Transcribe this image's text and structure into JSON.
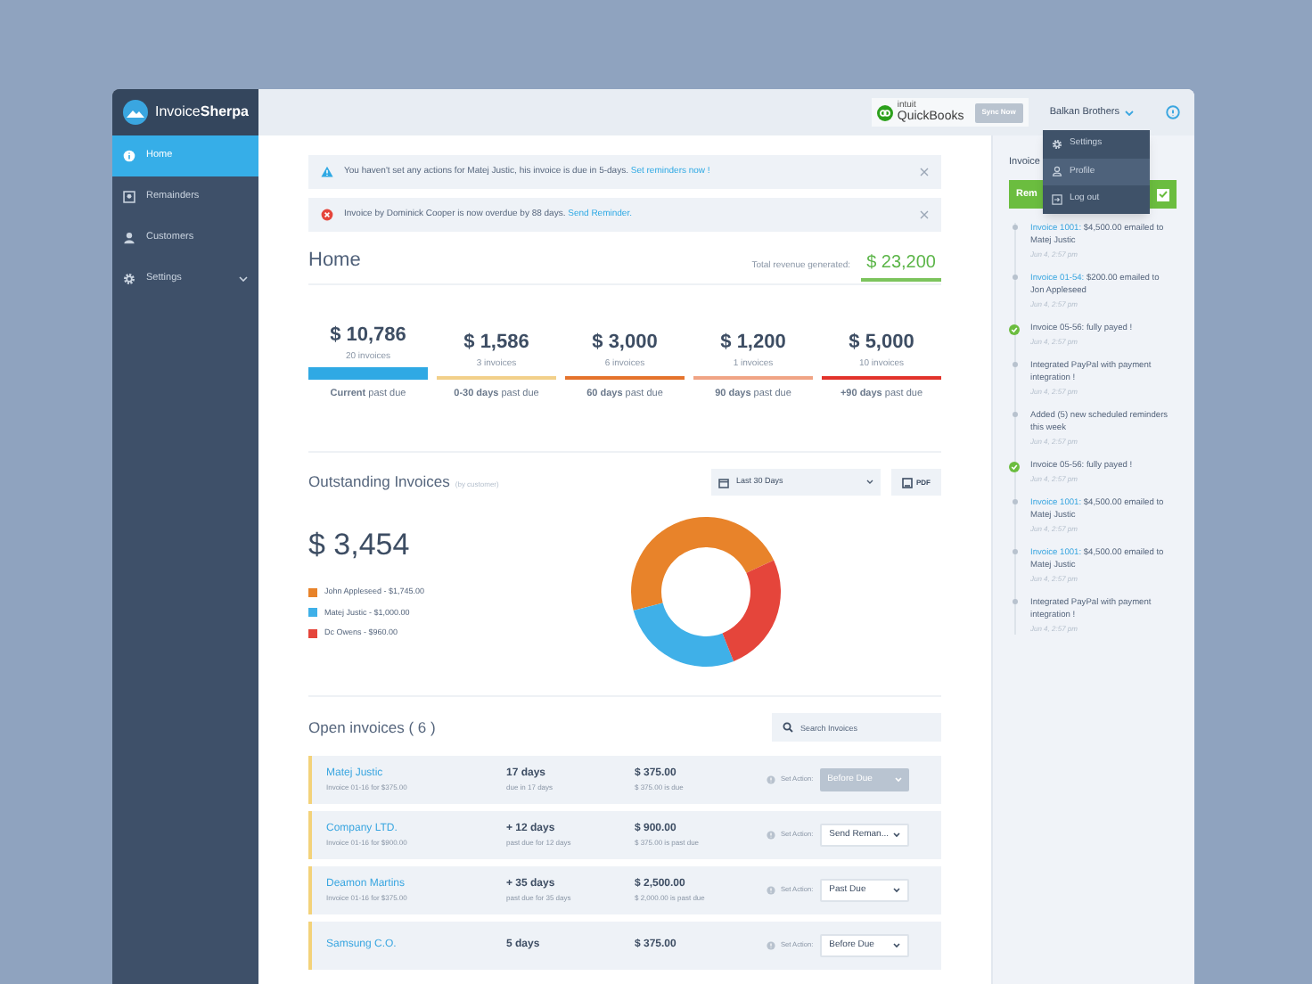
{
  "sidebar": {
    "logo": "Invoice**Sherpa**",
    "items": [
      {
        "label": "Home",
        "kind": "home",
        "selected": true,
        "expandable": false
      },
      {
        "label": "Remainders",
        "kind": "reminders",
        "selected": false,
        "expandable": false
      },
      {
        "label": "Customers",
        "kind": "customers",
        "selected": false,
        "expandable": false
      },
      {
        "label": "Settings",
        "kind": "settings",
        "selected": false,
        "expandable": true
      }
    ]
  },
  "top_bar": {
    "integration": {
      "brand_small": "intuit",
      "brand": "QuickBooks",
      "button": "Sync Now"
    },
    "account": "Balkan Brothers",
    "menu": [
      {
        "label": "Settings",
        "kind": "settings",
        "selected": false
      },
      {
        "label": "Profile",
        "kind": "profile",
        "selected": true
      },
      {
        "label": "Log out",
        "kind": "logout",
        "selected": false
      }
    ]
  },
  "alerts": [
    {
      "kind": "warning",
      "text": "You haven't set any actions for Matej Justic, his invoice is due in 5-days.",
      "link": "Set reminders now !"
    },
    {
      "kind": "error",
      "text": "Invoice by Dominick Cooper is now overdue by 88 days.",
      "link": "Send Reminder."
    }
  ],
  "home": {
    "title": "Home",
    "revenue_label": "Total revenue generated:",
    "revenue": "$ 23,200",
    "buckets": [
      {
        "amount": "$ 10,786",
        "count": "20 invoices",
        "label": "**Current** past due",
        "color": "#2fa9e4",
        "selected": true
      },
      {
        "amount": "$ 1,586",
        "count": "3 invoices",
        "label": "**0-30 days** past due",
        "color": "#f2d08a",
        "selected": false
      },
      {
        "amount": "$ 3,000",
        "count": "6 invoices",
        "label": "**60 days** past due",
        "color": "#e5732c",
        "selected": false
      },
      {
        "amount": "$ 1,200",
        "count": "1 invoices",
        "label": "**90 days** past due",
        "color": "#f0a485",
        "selected": false
      },
      {
        "amount": "$ 5,000",
        "count": "10 invoices",
        "label": "**+90 days** past due",
        "color": "#e2332b",
        "selected": false
      }
    ]
  },
  "outstanding": {
    "title": "Outstanding Invoices",
    "subtitle": "(by customer)",
    "range": "Last 30 Days",
    "pdf": "PDF",
    "total": "$ 3,454",
    "legend": [
      {
        "label": "John Appleseed - $1,745.00",
        "color": "#e8832a"
      },
      {
        "label": "Matej Justic - $1,000.00",
        "color": "#3fb0e8"
      },
      {
        "label": "Dc Owens - $960.00",
        "color": "#e5453b"
      }
    ],
    "chart_data": {
      "type": "donut",
      "values": [
        47.1,
        27,
        25.9
      ]
    }
  },
  "open_invoices": {
    "title": "Open invoices ( 6 )",
    "search_placeholder": "Search Invoices",
    "rows": [
      {
        "name": "Matej Justic",
        "invoice": "Invoice 01-16 for $375.00",
        "days": "17 days",
        "days_note": "due in 17 days",
        "amount": "$ 375.00",
        "amount_note": "$ 375.00 is due",
        "action_label": "Set Action:",
        "action": "Before Due",
        "disabled": true
      },
      {
        "name": "Company LTD.",
        "invoice": "Invoice 01-16 for $900.00",
        "days": "+ 12 days",
        "days_note": "past due for 12 days",
        "amount": "$ 900.00",
        "amount_note": "$ 375.00 is past due",
        "action_label": "Set Action:",
        "action": "Send Reman...",
        "disabled": false
      },
      {
        "name": "Deamon Martins",
        "invoice": "Invoice 01-16 for $375.00",
        "days": "+ 35 days",
        "days_note": "past due for 35 days",
        "amount": "$ 2,500.00",
        "amount_note": "$ 2,000.00 is past due",
        "action_label": "Set Action:",
        "action": "Past Due",
        "disabled": false
      },
      {
        "name": "Samsung C.O.",
        "days": "5 days",
        "amount": "$ 375.00",
        "action_label": "Set Action:",
        "action": "Before Due",
        "disabled": false
      }
    ]
  },
  "activity": {
    "title": "Invoice",
    "button": "Rem",
    "checked": true,
    "items": [
      {
        "kind": "event",
        "link": "Invoice 1001:",
        "text": "$4,500.00 emailed to Matej Justic",
        "time": "Jun 4, 2:57 pm"
      },
      {
        "kind": "event",
        "link": "Invoice 01-54:",
        "text": "$200.00 emailed to Jon Appleseed",
        "time": "Jun 4, 2:57 pm"
      },
      {
        "kind": "paid",
        "text": "Invoice 05-56: fully payed !",
        "time": "Jun 4, 2:57 pm"
      },
      {
        "kind": "event",
        "text": "Integrated PayPal with payment integration !",
        "time": "Jun 4, 2:57 pm"
      },
      {
        "kind": "event",
        "text": "Added (5) new scheduled reminders this week",
        "time": "Jun 4, 2:57 pm"
      },
      {
        "kind": "paid",
        "text": "Invoice 05-56: fully payed !",
        "time": "Jun 4, 2:57 pm"
      },
      {
        "kind": "event",
        "link": "Invoice 1001:",
        "text": "$4,500.00 emailed to Matej Justic",
        "time": "Jun 4, 2:57 pm"
      },
      {
        "kind": "event",
        "link": "Invoice 1001:",
        "text": "$4,500.00 emailed to Matej Justic",
        "time": "Jun 4, 2:57 pm"
      },
      {
        "kind": "event",
        "text": "Integrated PayPal with payment integration !",
        "time": "Jun 4, 2:57 pm"
      }
    ]
  }
}
